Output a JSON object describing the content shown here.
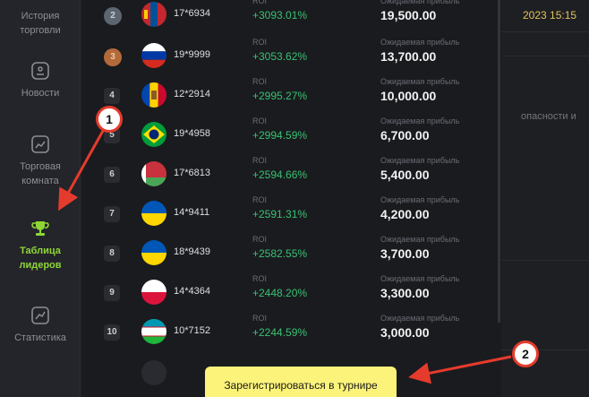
{
  "sidebar": {
    "items": [
      {
        "label": "История торговли",
        "icon": "history-icon"
      },
      {
        "label": "Новости",
        "icon": "news-icon"
      },
      {
        "label": "Торговая комната",
        "icon": "chart-icon"
      },
      {
        "label": "Таблица лидеров",
        "icon": "trophy-icon",
        "active": true
      },
      {
        "label": "Статистика",
        "icon": "statistics-icon"
      }
    ]
  },
  "leaderboard": {
    "roi_label": "ROI",
    "profit_label": "Ожидаемая прибыль",
    "rows": [
      {
        "rank": "2",
        "flag": "mongolia",
        "user": "17*6934",
        "roi": "+3093.01%",
        "profit": "19,500.00"
      },
      {
        "rank": "3",
        "flag": "russia",
        "user": "19*9999",
        "roi": "+3053.62%",
        "profit": "13,700.00"
      },
      {
        "rank": "4",
        "flag": "moldova",
        "user": "12*2914",
        "roi": "+2995.27%",
        "profit": "10,000.00"
      },
      {
        "rank": "5",
        "flag": "brazil",
        "user": "19*4958",
        "roi": "+2994.59%",
        "profit": "6,700.00"
      },
      {
        "rank": "6",
        "flag": "belarus",
        "user": "17*6813",
        "roi": "+2594.66%",
        "profit": "5,400.00"
      },
      {
        "rank": "7",
        "flag": "ukraine",
        "user": "14*9411",
        "roi": "+2591.31%",
        "profit": "4,200.00"
      },
      {
        "rank": "8",
        "flag": "ukraine",
        "user": "18*9439",
        "roi": "+2582.55%",
        "profit": "3,700.00"
      },
      {
        "rank": "9",
        "flag": "poland",
        "user": "14*4364",
        "roi": "+2448.20%",
        "profit": "3,300.00"
      },
      {
        "rank": "10",
        "flag": "uzbekistan",
        "user": "10*7152",
        "roi": "+2244.59%",
        "profit": "3,000.00"
      }
    ]
  },
  "right": {
    "datetime": "2023 15:15",
    "fragment": "опасности и"
  },
  "cta": {
    "label": "Зарегистрироваться в турнире"
  },
  "annotations": {
    "one": "1",
    "two": "2"
  },
  "colors": {
    "accent_green": "#8ed636",
    "roi_green": "#38c172",
    "cta_yellow": "#fcf37a",
    "annotation_red": "#e53b2c"
  }
}
